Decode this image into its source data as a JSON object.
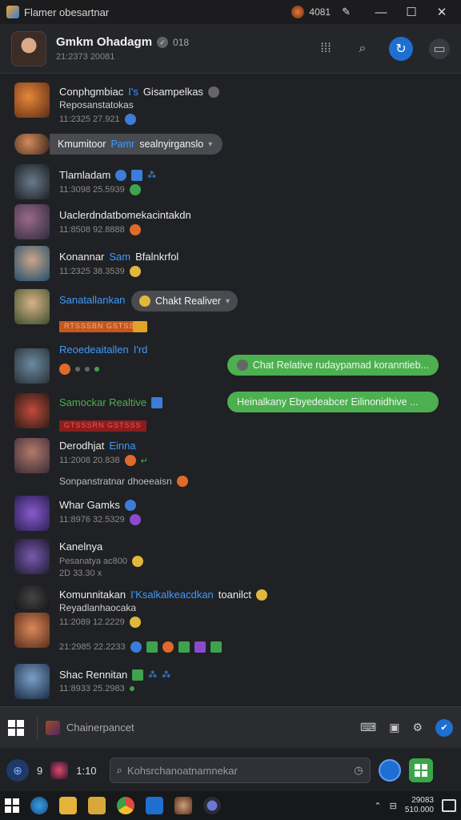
{
  "window": {
    "title": "Flamer obesartnar",
    "count": "4081",
    "controls": [
      "—",
      "☐",
      "✕"
    ]
  },
  "header": {
    "name": "Gmkm Ohadagm",
    "badge": "✓",
    "id": "018",
    "subtitle": "21:2373 20081"
  },
  "chats": [
    {
      "name": "Conphgmbiac",
      "name_accent": "I's",
      "name_rest": "Gisampelkas",
      "line2": "Reposanstatokas",
      "time": "11:2325 27.921"
    },
    {
      "pill_label": "Kmumitoor",
      "pill_accent": "Pamr",
      "pill_rest": "sealnyirganslo"
    },
    {
      "name": "Tlamladam",
      "time": "11:3098 25.5939"
    },
    {
      "name": "Uaclerdndatbomekacintakdn",
      "time": "11:8508 92.8888"
    },
    {
      "name": "Konannar",
      "name_accent": "Sam",
      "name_rest": "Bfalnkrfol",
      "time": "11:2325 38.3539"
    },
    {
      "name": "Sanatallankan",
      "pill_label": "Chakt Realiver",
      "tag": "RTSSSBN GSTSSS"
    },
    {
      "name": "Reoedeaitallen",
      "name_rest": "I'rd",
      "bubble": "Chat Relative rudaypamad koranntieb..."
    },
    {
      "name": "Samockar Realtive",
      "tag": "GTSSSRN GSTSSS",
      "bubble": "Heinalkany Ebyedeabcer Eilinonidhive ..."
    },
    {
      "name": "Derodhjat",
      "name_accent": "Einna",
      "time": "11:2008 20.838",
      "line3": "Sonpanstratnar dhoeeaisn"
    },
    {
      "name": "Whar Gamks",
      "time": "11:8976 32.5329"
    },
    {
      "name": "Kanelnya",
      "line2": "Pesanatya ac800",
      "time": "2D 33.30 x"
    },
    {
      "name": "Komunnitakan",
      "name_accent": "I'Ksalkalkeacdkan",
      "name_rest": "toanilct",
      "line2": "Reyadlanhaocaka",
      "time": "11:2089 12.2229"
    },
    {
      "time": "21:2985 22.2233"
    },
    {
      "name": "Shac Rennitan",
      "time": "11:8933 25.2983"
    }
  ],
  "composer": {
    "label": "Chainerpancet"
  },
  "input": {
    "left_text": "9",
    "count": "1:10",
    "placeholder": "Kohsrchanoatnamnekar"
  },
  "taskbar": {
    "time": "29083",
    "date": "510.000"
  }
}
